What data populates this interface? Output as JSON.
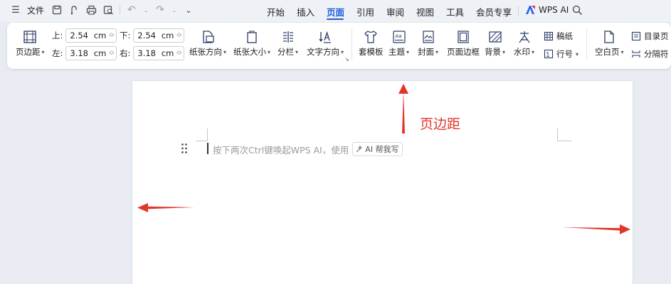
{
  "menubar": {
    "file_label": "文件",
    "tabs": [
      "开始",
      "插入",
      "页面",
      "引用",
      "审阅",
      "视图",
      "工具",
      "会员专享"
    ],
    "active_tab": "页面",
    "wps_ai": "WPS AI"
  },
  "ribbon": {
    "margins_btn": "页边距",
    "top_label": "上:",
    "top_value": "2.54",
    "bottom_label": "下:",
    "bottom_value": "2.54",
    "left_label": "左:",
    "left_value": "3.18",
    "right_label": "右:",
    "right_value": "3.18",
    "unit": "cm",
    "orientation": "纸张方向",
    "paper_size": "纸张大小",
    "columns": "分栏",
    "text_direction": "文字方向",
    "template": "套模板",
    "theme": "主题",
    "cover": "封面",
    "page_border": "页面边框",
    "background": "背景",
    "watermark": "水印",
    "manuscript": "稿纸",
    "line_number": "行号",
    "blank_page": "空白页",
    "toc_page": "目录页",
    "separator": "分隔符"
  },
  "document": {
    "placeholder": "按下两次Ctrl键唤起WPS AI，使用",
    "ai_chip": "AI 帮我写"
  },
  "annotation": {
    "label": "页边距",
    "color": "#e0362b"
  }
}
